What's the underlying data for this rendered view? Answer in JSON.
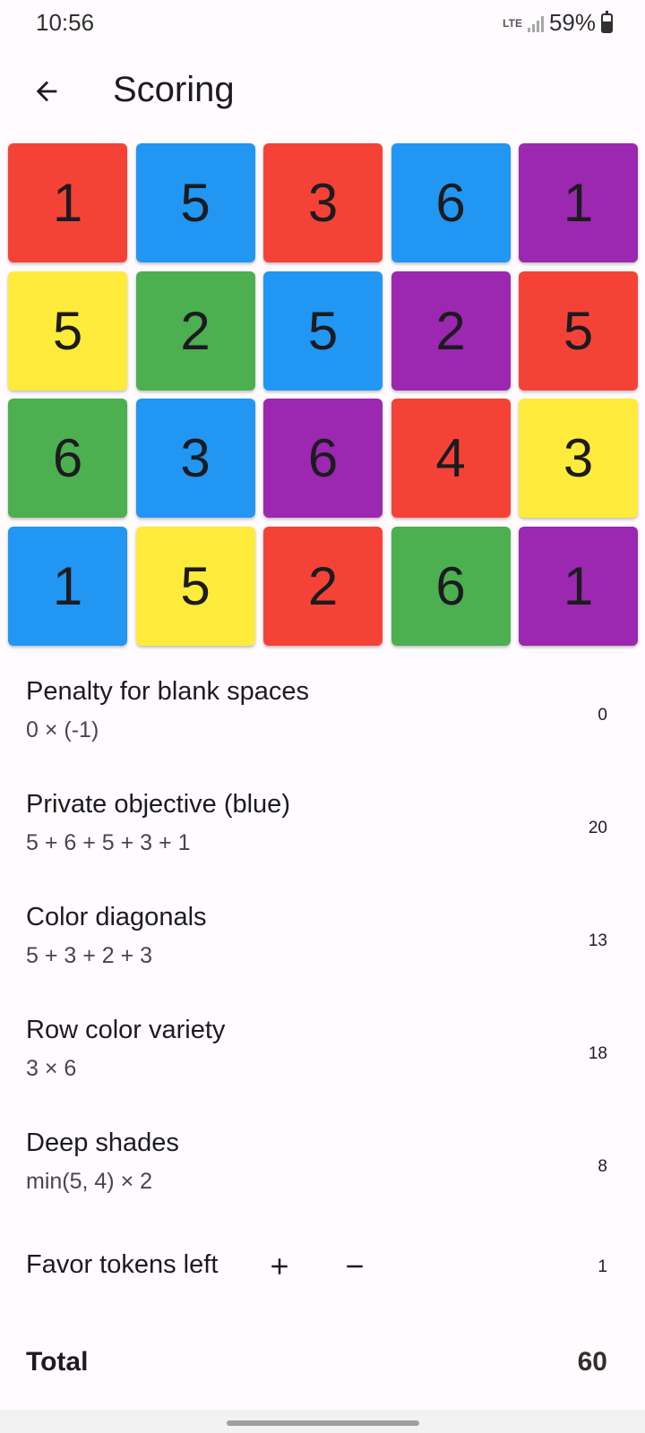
{
  "status": {
    "time": "10:56",
    "network": "LTE",
    "battery": "59%"
  },
  "header": {
    "title": "Scoring"
  },
  "colors": {
    "red": "#f44336",
    "blue": "#2196f3",
    "purple": "#9c27b0",
    "yellow": "#ffeb3b",
    "green": "#4caf50"
  },
  "grid": [
    [
      {
        "value": "1",
        "color": "#f44336"
      },
      {
        "value": "5",
        "color": "#2196f3"
      },
      {
        "value": "3",
        "color": "#f44336"
      },
      {
        "value": "6",
        "color": "#2196f3"
      },
      {
        "value": "1",
        "color": "#9c27b0"
      }
    ],
    [
      {
        "value": "5",
        "color": "#ffeb3b"
      },
      {
        "value": "2",
        "color": "#4caf50"
      },
      {
        "value": "5",
        "color": "#2196f3"
      },
      {
        "value": "2",
        "color": "#9c27b0"
      },
      {
        "value": "5",
        "color": "#f44336"
      }
    ],
    [
      {
        "value": "6",
        "color": "#4caf50"
      },
      {
        "value": "3",
        "color": "#2196f3"
      },
      {
        "value": "6",
        "color": "#9c27b0"
      },
      {
        "value": "4",
        "color": "#f44336"
      },
      {
        "value": "3",
        "color": "#ffeb3b"
      }
    ],
    [
      {
        "value": "1",
        "color": "#2196f3"
      },
      {
        "value": "5",
        "color": "#ffeb3b"
      },
      {
        "value": "2",
        "color": "#f44336"
      },
      {
        "value": "6",
        "color": "#4caf50"
      },
      {
        "value": "1",
        "color": "#9c27b0"
      }
    ]
  ],
  "scores": [
    {
      "label": "Penalty for blank spaces",
      "formula": "0 × (-1)",
      "value": "0"
    },
    {
      "label": "Private objective (blue)",
      "formula": "5 + 6 + 5 + 3 + 1",
      "value": "20"
    },
    {
      "label": "Color diagonals",
      "formula": "5 + 3 + 2 + 3",
      "value": "13"
    },
    {
      "label": "Row color variety",
      "formula": "3 × 6",
      "value": "18"
    },
    {
      "label": "Deep shades",
      "formula": "min(5, 4) × 2",
      "value": "8"
    }
  ],
  "favor": {
    "label": "Favor tokens left",
    "value": "1"
  },
  "total": {
    "label": "Total",
    "value": "60"
  }
}
